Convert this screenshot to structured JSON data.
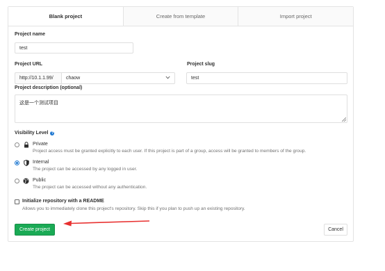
{
  "tabs": [
    {
      "label": "Blank project",
      "active": true
    },
    {
      "label": "Create from template",
      "active": false
    },
    {
      "label": "Import project",
      "active": false
    }
  ],
  "project_name": {
    "label": "Project name",
    "value": "test"
  },
  "project_url": {
    "label": "Project URL",
    "prefix": "http://10.1.1.99/",
    "namespace": "chaow"
  },
  "project_slug": {
    "label": "Project slug",
    "value": "test"
  },
  "description": {
    "label": "Project description (optional)",
    "value": "这是一个测试项目"
  },
  "visibility": {
    "label": "Visibility Level",
    "help_icon": "?",
    "options": [
      {
        "title": "Private",
        "desc": "Project access must be granted explicitly to each user. If this project is part of a group, access will be granted to members of the group.",
        "icon": "lock-icon",
        "checked": false
      },
      {
        "title": "Internal",
        "desc": "The project can be accessed by any logged in user.",
        "icon": "shield-icon",
        "checked": true
      },
      {
        "title": "Public",
        "desc": "The project can be accessed without any authentication.",
        "icon": "globe-icon",
        "checked": false
      }
    ]
  },
  "readme": {
    "label": "Initialize repository with a README",
    "desc": "Allows you to immediately clone this project's repository. Skip this if you plan to push up an existing repository.",
    "checked": false
  },
  "buttons": {
    "create": "Create project",
    "cancel": "Cancel"
  },
  "colors": {
    "primary": "#1aaa55",
    "accent": "#1f78d1",
    "annotation_arrow": "#e8302f"
  }
}
